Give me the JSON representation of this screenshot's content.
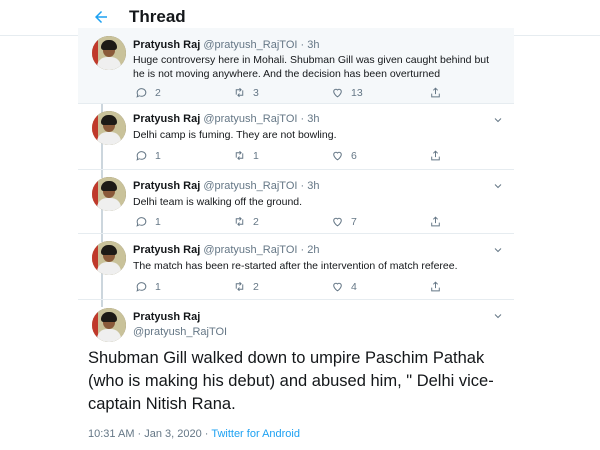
{
  "header": {
    "title": "Thread",
    "back_icon": "arrow-left-icon"
  },
  "colors": {
    "accent": "#1da1f2",
    "muted": "#657786",
    "rail": "#ccd6dd"
  },
  "tweets": [
    {
      "name": "Pratyush Raj",
      "handle": "@pratyush_RajTOI",
      "time": "· 3h",
      "text": "Huge controversy here in Mohali. Shubman Gill was given caught behind but he is not moving anywhere. And the decision has been overturned",
      "replies": "2",
      "retweets": "3",
      "likes": "13"
    },
    {
      "name": "Pratyush Raj",
      "handle": "@pratyush_RajTOI",
      "time": "· 3h",
      "text": "Delhi camp is fuming. They are not bowling.",
      "replies": "1",
      "retweets": "1",
      "likes": "6"
    },
    {
      "name": "Pratyush Raj",
      "handle": "@pratyush_RajTOI",
      "time": "· 3h",
      "text": "Delhi team is walking off the ground.",
      "replies": "1",
      "retweets": "2",
      "likes": "7"
    },
    {
      "name": "Pratyush Raj",
      "handle": "@pratyush_RajTOI",
      "time": "· 2h",
      "text": "The match has been re-started after the intervention of match referee.",
      "replies": "1",
      "retweets": "2",
      "likes": "4"
    }
  ],
  "main_tweet": {
    "name": "Pratyush Raj",
    "handle": "@pratyush_RajTOI",
    "text": "Shubman Gill walked down to umpire Paschim Pathak (who is making his debut) and abused him, \" Delhi vice-captain Nitish Rana.",
    "timestamp": "10:31 AM · Jan 3, 2020 · ",
    "source": "Twitter for Android"
  }
}
